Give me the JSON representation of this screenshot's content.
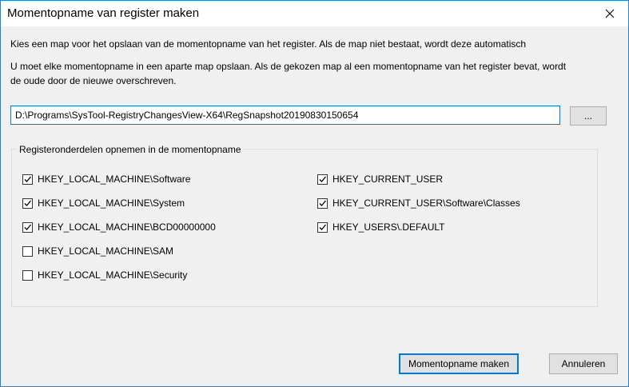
{
  "window": {
    "title": "Momentopname van register maken"
  },
  "intro": {
    "line1": "Kies een map voor het opslaan van de momentopname van het register. Als de map niet bestaat, wordt deze automatisch",
    "line2": "U moet elke momentopname in een aparte map opslaan. Als de gekozen map al een momentopname van het register bevat, wordt",
    "line3": "de oude door de nieuwe overschreven."
  },
  "path": {
    "value": "D:\\Programs\\SysTool-RegistryChangesView-X64\\RegSnapshot20190830150654",
    "browse_label": "..."
  },
  "group": {
    "label": "Registeronderdelen opnemen in de momentopname",
    "left_items": [
      {
        "label": "HKEY_LOCAL_MACHINE\\Software",
        "checked": true
      },
      {
        "label": "HKEY_LOCAL_MACHINE\\System",
        "checked": true
      },
      {
        "label": "HKEY_LOCAL_MACHINE\\BCD00000000",
        "checked": true
      },
      {
        "label": "HKEY_LOCAL_MACHINE\\SAM",
        "checked": false
      },
      {
        "label": "HKEY_LOCAL_MACHINE\\Security",
        "checked": false
      }
    ],
    "right_items": [
      {
        "label": "HKEY_CURRENT_USER",
        "checked": true
      },
      {
        "label": "HKEY_CURRENT_USER\\Software\\Classes",
        "checked": true
      },
      {
        "label": "HKEY_USERS\\.DEFAULT",
        "checked": true
      }
    ]
  },
  "buttons": {
    "ok_label": "Momentopname maken",
    "cancel_label": "Annuleren"
  },
  "colors": {
    "accent": "#0078d7",
    "dialog_bg": "#f0f0f0",
    "button_bg": "#e1e1e1"
  },
  "icons": {
    "close": "close-icon",
    "check": "checkmark-icon"
  }
}
